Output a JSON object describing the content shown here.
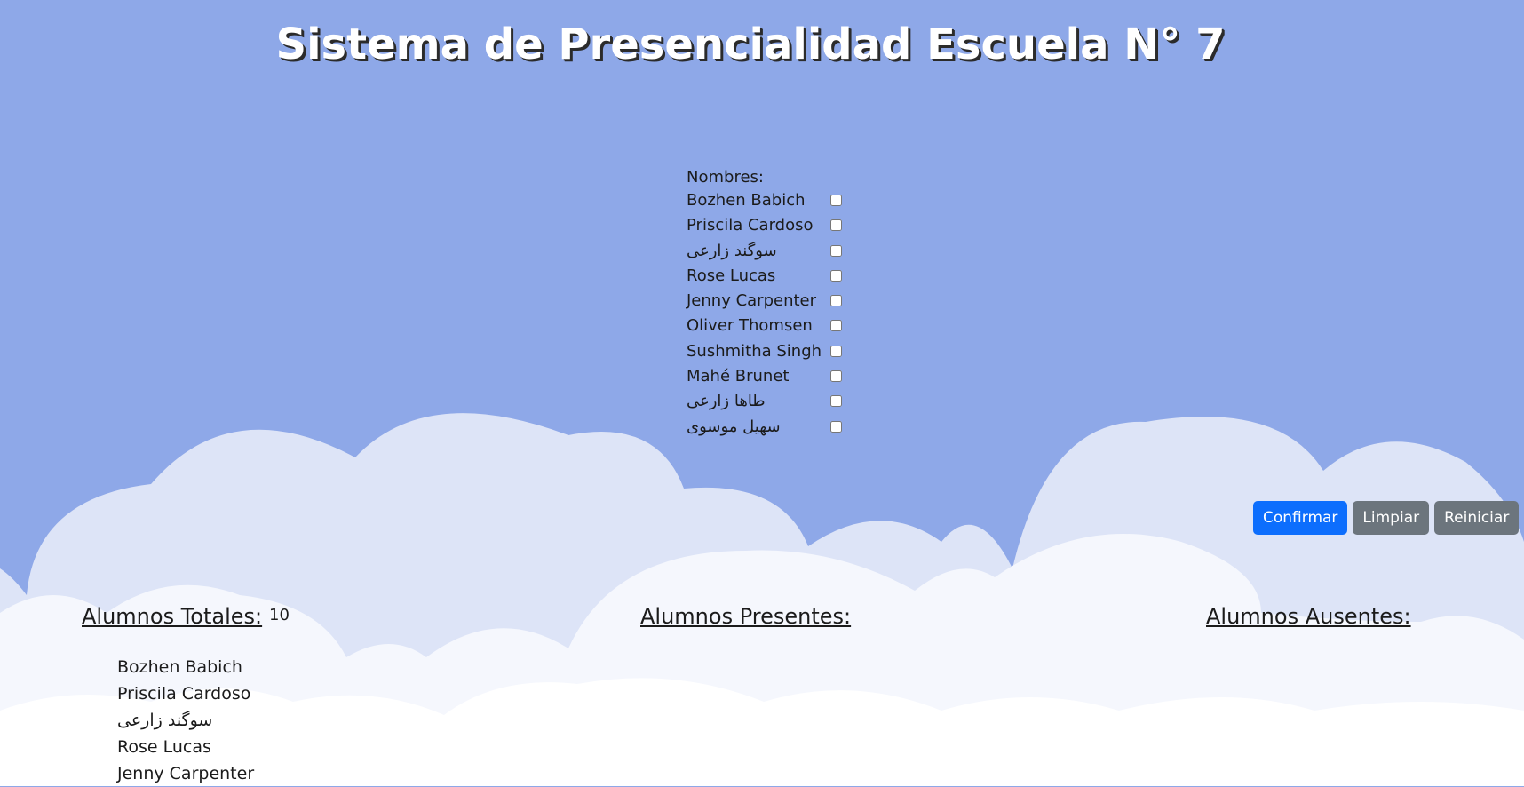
{
  "page": {
    "title": "Sistema de Presencialidad Escuela N° 7"
  },
  "attendance": {
    "names_header": "Nombres:",
    "students": [
      {
        "name": "Bozhen Babich",
        "checked": false
      },
      {
        "name": "Priscila Cardoso",
        "checked": false
      },
      {
        "name": "سوگند زارعی",
        "checked": false
      },
      {
        "name": "Rose Lucas",
        "checked": false
      },
      {
        "name": "Jenny Carpenter",
        "checked": false
      },
      {
        "name": "Oliver Thomsen",
        "checked": false
      },
      {
        "name": "Sushmitha Singh",
        "checked": false
      },
      {
        "name": "Mahé Brunet",
        "checked": false
      },
      {
        "name": "طاها زارعی",
        "checked": false
      },
      {
        "name": "سهیل موسوی",
        "checked": false
      }
    ]
  },
  "actions": {
    "confirm_label": "Confirmar",
    "clear_label": "Limpiar",
    "reset_label": "Reiniciar"
  },
  "summary": {
    "total_heading": "Alumnos Totales:",
    "total_count": "10",
    "present_heading": "Alumnos Presentes:",
    "absent_heading": "Alumnos Ausentes:",
    "total_list": [
      "Bozhen Babich",
      "Priscila Cardoso",
      "سوگند زارعی",
      "Rose Lucas",
      "Jenny Carpenter"
    ]
  },
  "colors": {
    "sky": "#8ea8e8",
    "cloud_back": "#dde4f7",
    "cloud_front": "#f7f8fd",
    "primary": "#0d6efd",
    "secondary": "#6c757d"
  }
}
